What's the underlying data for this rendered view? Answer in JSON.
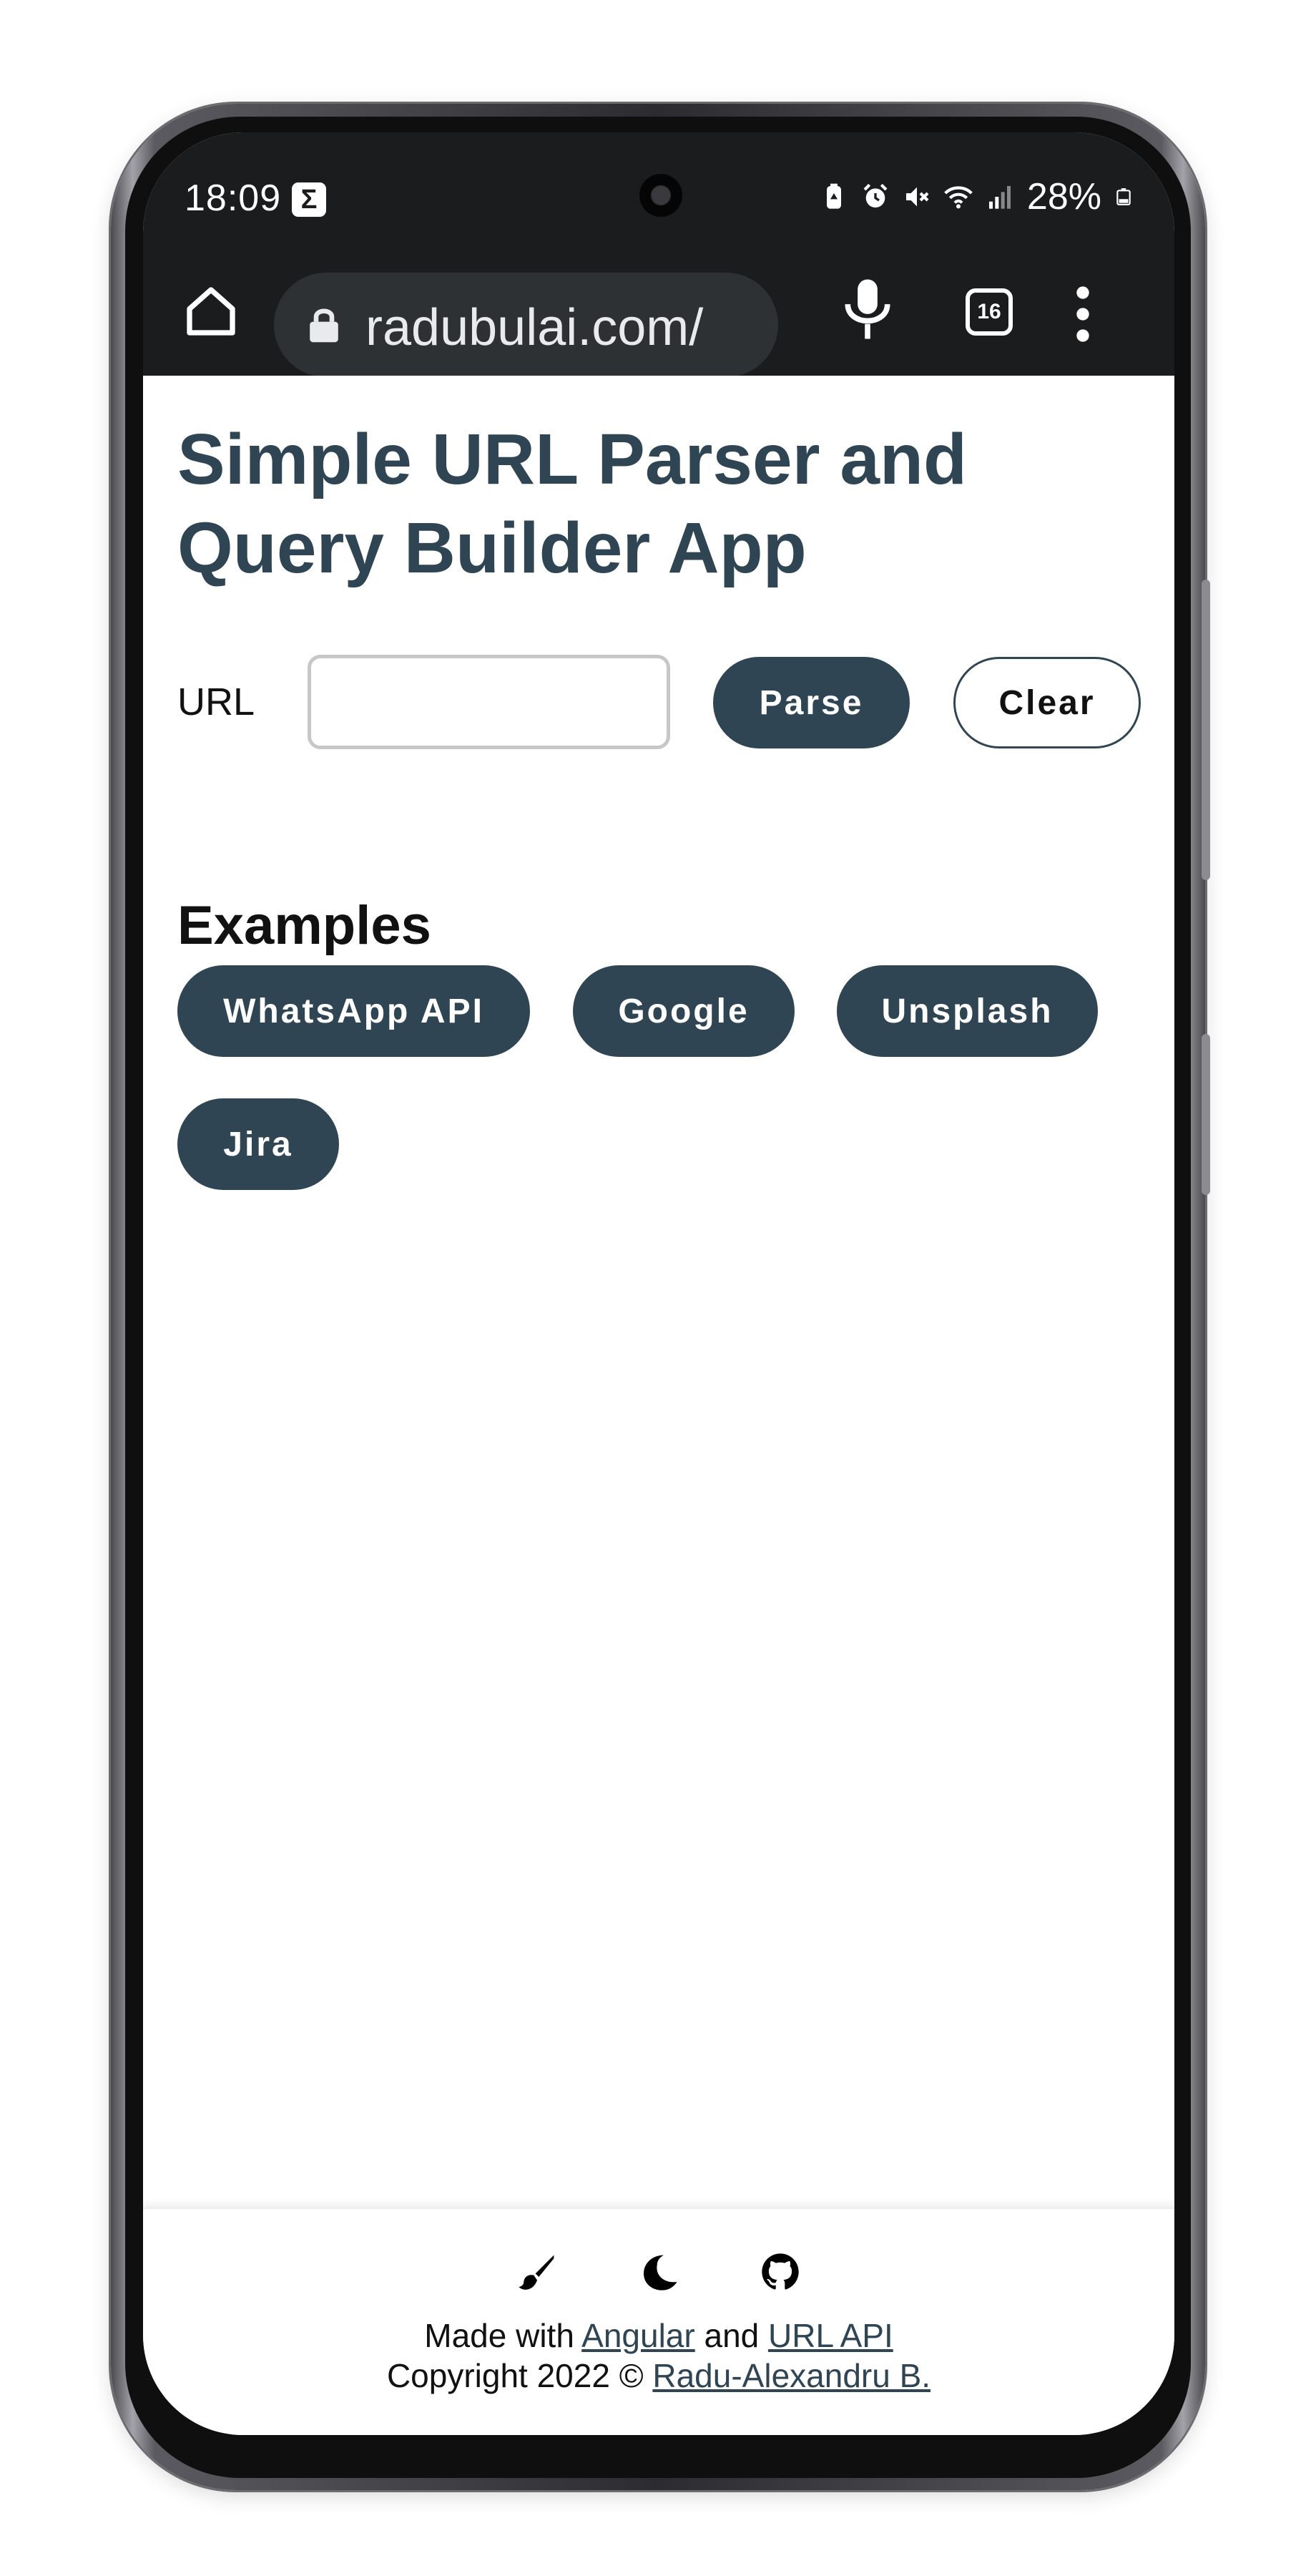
{
  "status_bar": {
    "time": "18:09",
    "notification_icon": "sigma-icon",
    "battery_percent": "28%",
    "icons": [
      "battery-saver-icon",
      "alarm-icon",
      "mute-icon",
      "wifi-icon",
      "signal-icon",
      "battery-icon"
    ]
  },
  "browser": {
    "url_display": "radubulai.com/",
    "tab_count": "16",
    "icons": [
      "home-icon",
      "lock-icon",
      "mic-icon",
      "tabs-icon",
      "menu-icon"
    ]
  },
  "page": {
    "title": "Simple URL Parser and Query Builder App",
    "url_label": "URL",
    "url_input_value": "",
    "parse_button": "Parse",
    "clear_button": "Clear",
    "examples_heading": "Examples",
    "examples": [
      {
        "label": "WhatsApp API"
      },
      {
        "label": "Google"
      },
      {
        "label": "Unsplash"
      },
      {
        "label": "Jira"
      }
    ]
  },
  "footer": {
    "icons": [
      "brush-icon",
      "moon-icon",
      "github-icon"
    ],
    "made_with_prefix": "Made with",
    "angular_link": "Angular",
    "and_text": "and",
    "url_api_link": "URL API",
    "copyright_prefix": "Copyright 2022 ©",
    "author_link": "Radu-Alexandru B."
  },
  "colors": {
    "accent": "#2f4553",
    "browser_bar": "#1b1c1e",
    "url_pill": "#2e3134"
  }
}
